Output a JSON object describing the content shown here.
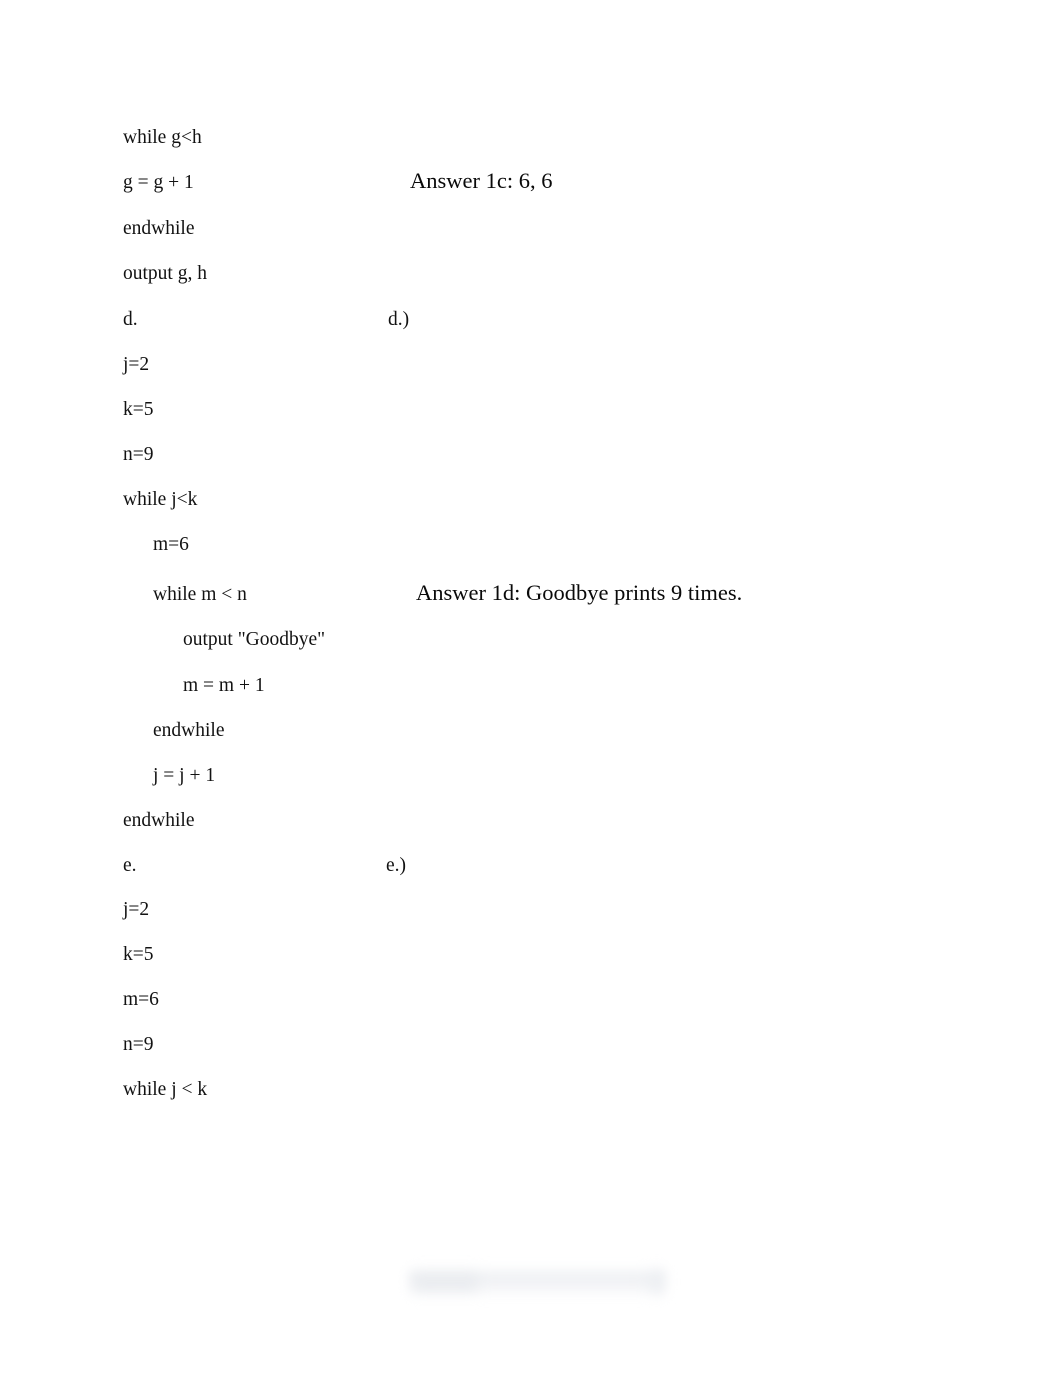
{
  "document": {
    "page_background": "#ffffff",
    "text_color": "#121212",
    "left_column": {
      "lines": [
        {
          "text": "while g<h",
          "indent": 0
        },
        {
          "text": "g = g + 1",
          "indent": 0
        },
        {
          "text": "endwhile",
          "indent": 0
        },
        {
          "text": "output g, h",
          "indent": 0
        },
        {
          "text": "d.",
          "indent": 0
        },
        {
          "text": "j=2",
          "indent": 0
        },
        {
          "text": "k=5",
          "indent": 0
        },
        {
          "text": "n=9",
          "indent": 0
        },
        {
          "text": "while j<k",
          "indent": 0
        },
        {
          "text": "m=6",
          "indent": 1
        },
        {
          "text": "while m < n",
          "indent": 1
        },
        {
          "text": "output \"Goodbye\"",
          "indent": 2
        },
        {
          "text": "m = m + 1",
          "indent": 2
        },
        {
          "text": "endwhile",
          "indent": 1
        },
        {
          "text": "j = j + 1",
          "indent": 1
        },
        {
          "text": "endwhile",
          "indent": 0
        },
        {
          "text": "e.",
          "indent": 0
        },
        {
          "text": "j=2",
          "indent": 0
        },
        {
          "text": "k=5",
          "indent": 0
        },
        {
          "text": "m=6",
          "indent": 0
        },
        {
          "text": "n=9",
          "indent": 0
        },
        {
          "text": "while j < k",
          "indent": 0
        }
      ]
    },
    "right_column": {
      "answers": [
        {
          "text": "Answer 1c: 6, 6"
        },
        {
          "text": "Answer 1d: Goodbye prints 9 times."
        }
      ],
      "markers": [
        {
          "text": "d.)"
        },
        {
          "text": "e.)"
        }
      ]
    }
  }
}
